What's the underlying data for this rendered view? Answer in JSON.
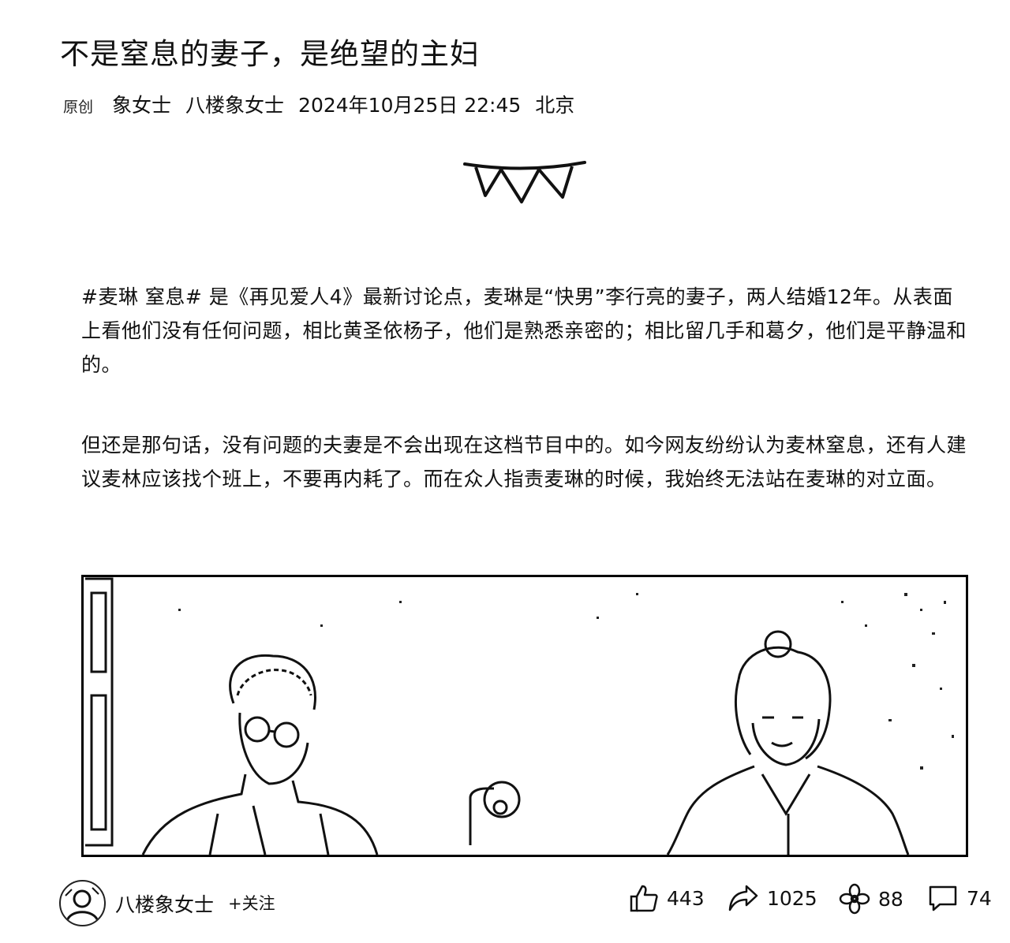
{
  "article": {
    "title": "不是窒息的妻子，是绝望的主妇",
    "original_badge": "原创",
    "author": "象女士",
    "account": "八楼象女士",
    "date": "2024年10月25日 22:45",
    "location": "北京",
    "paragraphs": [
      "#麦琳 窒息# 是《再见爱人4》最新讨论点，麦琳是“快男”李行亮的妻子，两人结婚12年。从表面上看他们没有任何问题，相比黄圣依杨子，他们是熟悉亲密的；相比留几手和葛夕，他们是平静温和的。",
      "但还是那句话，没有问题的夫妻是不会出现在这档节目中的。如今网友纷纷认为麦林窒息，还有人建议麦林应该找个班上，不要再内耗了。而在众人指责麦琳的时候，我始终无法站在麦琳的对立面。"
    ]
  },
  "footer": {
    "account_name": "八楼象女士",
    "follow_label": "+关注",
    "likes": "443",
    "shares": "1025",
    "recommends": "88",
    "comments": "74"
  },
  "icons": {
    "decoration": "bunting-flag-icon",
    "like": "thumbs-up-icon",
    "share": "share-arrow-icon",
    "recommend": "flower-icon",
    "comment": "comment-bubble-icon"
  }
}
